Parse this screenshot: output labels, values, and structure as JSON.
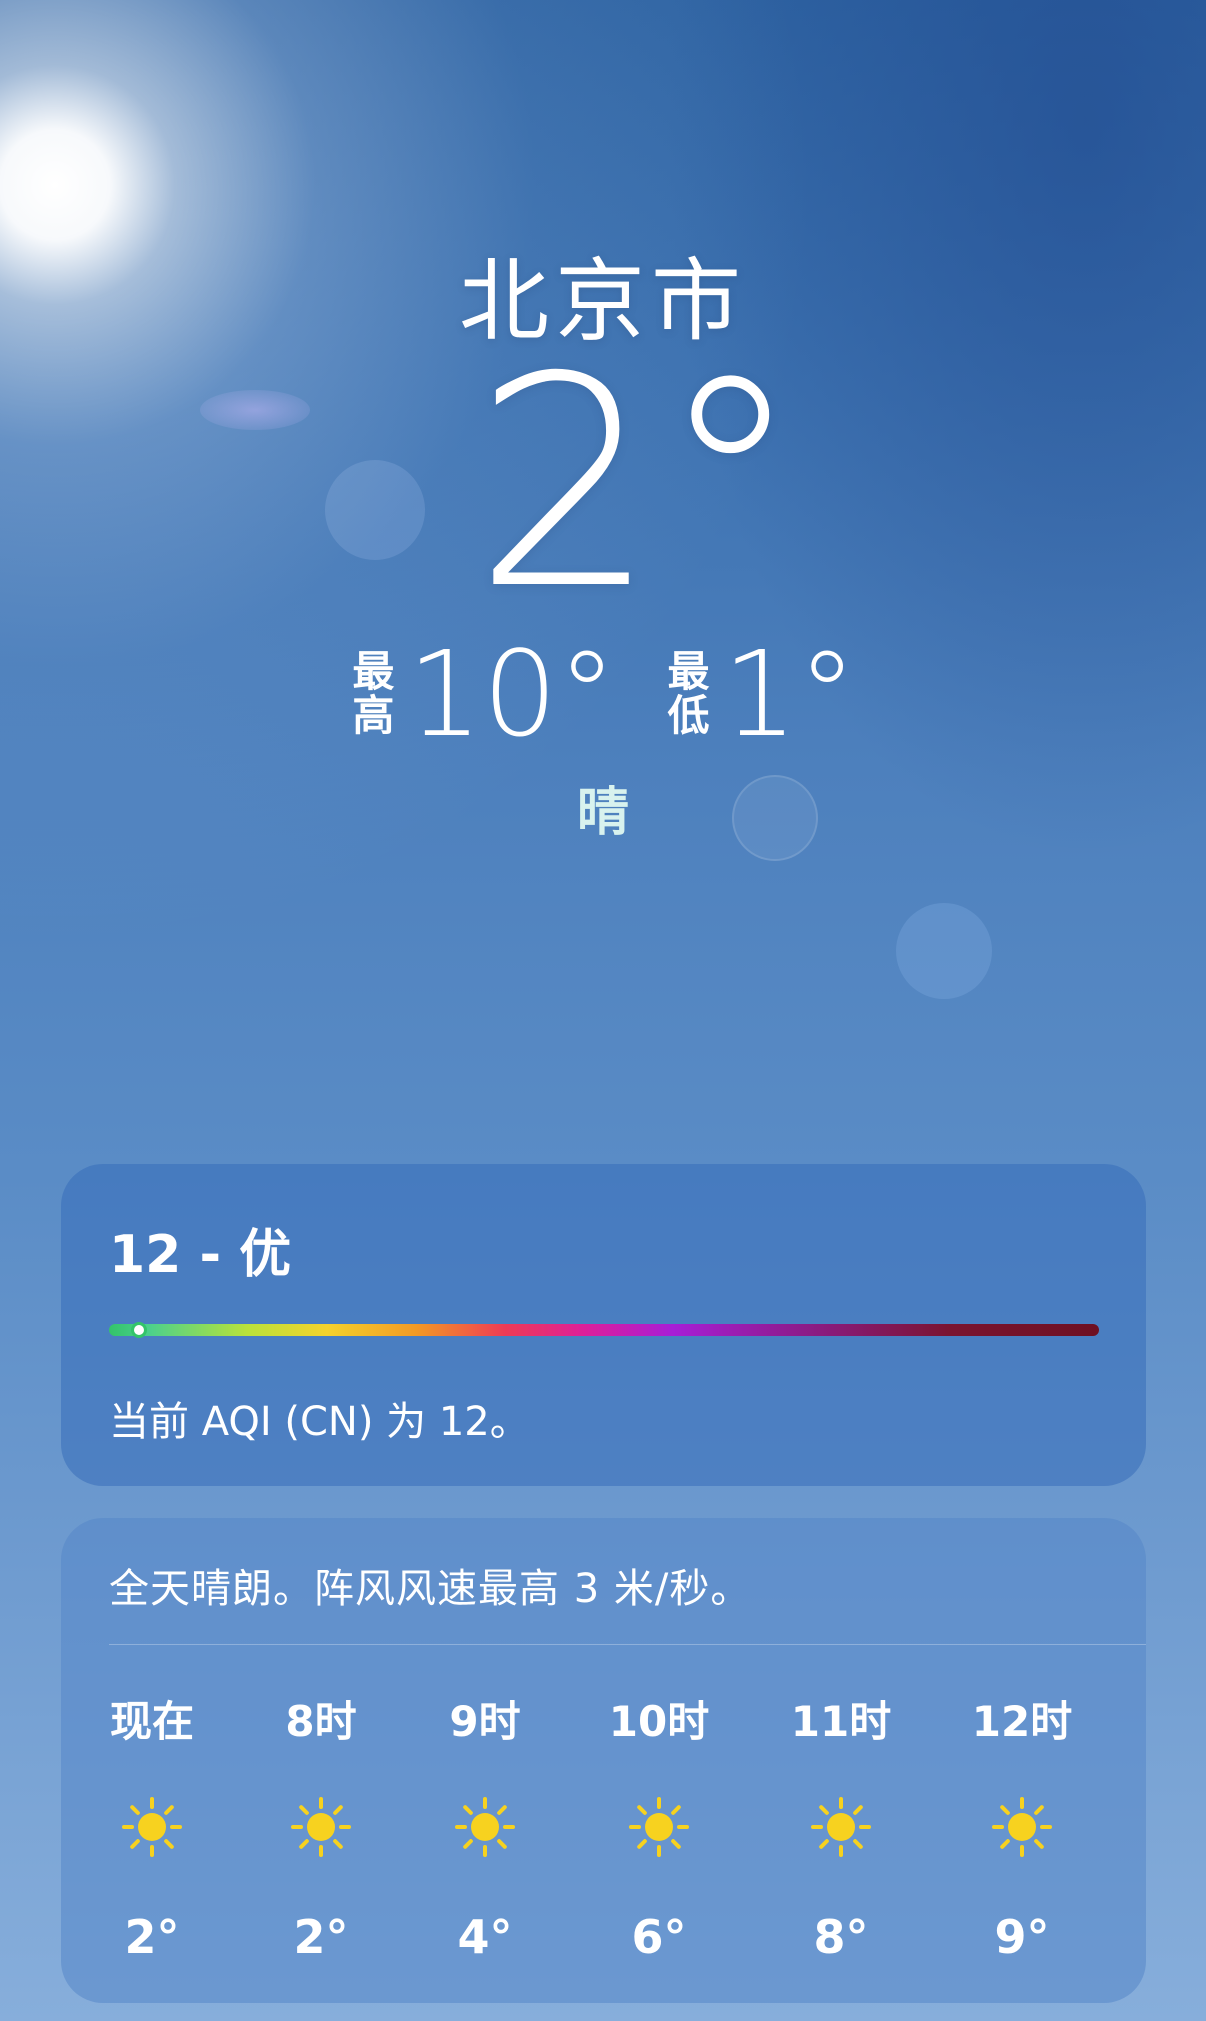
{
  "location": {
    "city": "北京市",
    "current_temp": "2°",
    "high_label": "最高",
    "high_value": "10°",
    "low_label": "最低",
    "low_value": "1°",
    "condition": "晴"
  },
  "aqi": {
    "title": "12 - 优",
    "description": "当前 AQI (CN) 为 12。",
    "value": 12,
    "scale_fraction": 0.03
  },
  "forecast": {
    "summary": "全天晴朗。阵风风速最高 3 米/秒。",
    "hours": [
      {
        "time": "现在",
        "icon": "sun-icon",
        "temp": "2°"
      },
      {
        "time": "8时",
        "icon": "sun-icon",
        "temp": "2°"
      },
      {
        "time": "9时",
        "icon": "sun-icon",
        "temp": "4°"
      },
      {
        "time": "10时",
        "icon": "sun-icon",
        "temp": "6°"
      },
      {
        "time": "11时",
        "icon": "sun-icon",
        "temp": "8°"
      },
      {
        "time": "12时",
        "icon": "sun-icon",
        "temp": "9°"
      }
    ]
  },
  "colors": {
    "sun": "#F7D21F",
    "aqi_good": "#33C46A"
  }
}
